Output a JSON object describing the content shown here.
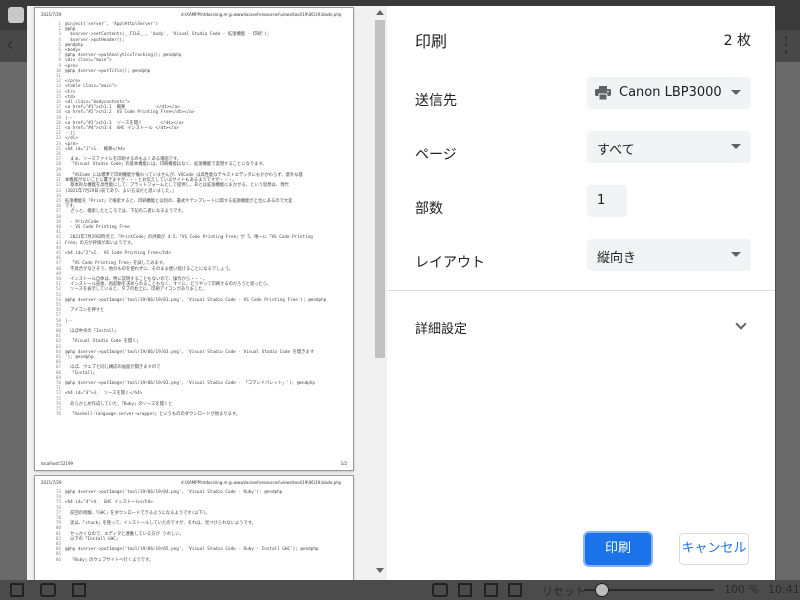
{
  "dialog": {
    "title": "印刷",
    "sheet_count": "2 枚",
    "destination_label": "送信先",
    "destination_value": "Canon LBP3000",
    "pages_label": "ページ",
    "pages_value": "すべて",
    "copies_label": "部数",
    "copies_value": "1",
    "layout_label": "レイアウト",
    "layout_value": "縦向き",
    "advanced_label": "詳細設定",
    "print_button": "印刷",
    "cancel_button": "キャンセル"
  },
  "preview": {
    "page1_date": "2021/7/29",
    "page1_url": "d:\\XAMPP\\htdocs\\ing.m-jp.www\\laravel\\resources\\views\\tool\\19\\06\\19.blade.php",
    "page1_footer_left": "localhost:52199",
    "page1_footer_right": "1/2",
    "page2_date": "2021/7/29",
    "page2_url": "d:\\XAMPP\\htdocs\\ing.m-jp.www\\laravel\\resources\\views\\tool\\19\\06\\19.blade.php",
    "page1_lines": [
      "@inject('server', 'App\\Http\\Server')",
      "@php",
      "  $server->setContents(__FILE__, 'body', 'Visual Studio Code - 拡張機能 - 印刷');",
      "  $server->putHeader();",
      "@endphp",
      "<body>",
      "@php $server->putAnalyticsTracking(); @endphp",
      "<div class=\"main\">",
      "<pre>",
      "@php $server->putTitle(); @endphp",
      "",
      "</pre>",
      "<table class=\"main\">",
      "<tr>",
      "<td>",
      "<dl class=\"bodycontents\">",
      "<a href=\"#1\">ch1:1  概要            </dt></a>",
      "<a href=\"#2\">ch1:2  VS Code Printing Free</dt></a>",
      "|--",
      "<a href=\"#3\">ch1:3  ソースを開く       </dt></a>",
      "<a href=\"#4\">ch1:4  GHC インストール </dt></a>",
      "--||",
      "</dl>",
      "<pre>",
      "<h4 id=\"1\">1.  概要</h4>",
      "",
      "  まぁ、ソースファイルを印刷するのもよくある場面です。",
      "  「Visual Studio Code」の基本機能には、印刷機能はなく、拡張機能で実現することになります。",
      "",
      "  「VSCode には標準で印刷機能が備わっていませんが、VSCode は高性能なテキストエディタにもかかわらず、意外な基",
      "本機能がないことに驚きますが・・・とお伝えしているサイトもあるようですが・・・。",
      "  基本的な機能を高性能にして、プラットフォームとして提供し、あとは拡張機能にまかせる、という思想は、現代",
      "(2021年7月29日)前であり、よい方法だと思いました。」",
      "",
      "拡張機能を「Print」で検索すると、印刷機能とは別の、書式やテンプレートに関する拡張機能が上位にあるので大変",
      "です。",
      "  ざっと、検索したところでは、下記の二者になるようです。",
      "",
      "  - PrintCode",
      "  - VS Code Printing Free",
      "",
      "  2021年7月29日時点で、「PrintCode」の評価が 4.5、「VS Code Printing Free」が 5、唯一に「VS Code Printing",
      "Free」の方が評価が高いようです。",
      "",
      "<h4 id=\"2\">2.  VS Code Printing Free</h4>",
      "",
      "  「VS Code Printing Free」を試してみます。",
      "  不具合がなさそう、他のものを使わずに、そのまま使い続けることになるでしょう。",
      "",
      "  インストール自体は、特に説明することもないので、操作から・・・。",
      "  インストール直後、再起動を求められることもなく、すぐに、どうやって印刷するのだろうと思ったら、",
      "  ソースを表示していると、タブの右上に、印刷アイコンがありました。",
      "",
      "@php $server->putImage('tool/19/06/19/01.png', 'Visual Studio Code - VS Code Printing Free'); @endphp",
      "",
      "  アイコンを押すと",
      "",
      "|--",
      "",
      "  ほぼ中央の「Install」",
      "",
      "  「Visual Studio Code を開く」",
      "",
      "@php $server->putImage('tool/19/06/19/03.png', 'Visual Studio Code - Visual Studio Code を開きます",
      "'); @endphp",
      "",
      "  ほぼ、ウェブと同じ構成の画面が開きますので",
      "  「Install」",
      "",
      "@php $server->putImage('tool/19/06/19/03.png', 'Visual Studio Code - 「コマンドパレット」'); @endphp",
      "",
      "<h4 id=\"3\">3.  ソースを開く</h4>",
      "",
      "  あらかじめ作成していた、「Ruby」のソースを開くと",
      "",
      "  「haskell-language-server-wrapper」というもののダウンロードが始まります。"
    ],
    "page2_lines": [
      "@php $server->putImage('tool/19/06/19/04.png', 'Visual Studio Code - Ruby'); @endphp",
      "",
      "<h4 id=\"4\">4.  GHC インストール</h4>",
      "",
      "  前回の経験、「GHC」をダウンロードできるようになるようです(以下)。",
      "",
      "  実は、「stack」を使って、インストールしていたのですが、それは、見つけられないようです。",
      "",
      "  せっかくなので、エディタと連動している方が うれしい。",
      "  以下の「Install GHC」",
      "",
      "@php $server->putImage('tool/19/06/19/05.png', 'Visual Studio Code - Ruby - Install GHC'); @endphp",
      "",
      "  「Ruby」のウェブサイトへ行くようです。"
    ],
    "page1_start_line": 1,
    "page2_start_line": 73
  },
  "statusbar": {
    "reset_label": "リセット",
    "zoom_level": "100 %",
    "zoom_fraction": 0.14,
    "clock": "10:41"
  },
  "icons": {
    "printer": "printer-icon",
    "chevron": "chevron-down-icon"
  },
  "colors": {
    "accent": "#1a73e8",
    "select_bg": "#f1f3f4"
  }
}
